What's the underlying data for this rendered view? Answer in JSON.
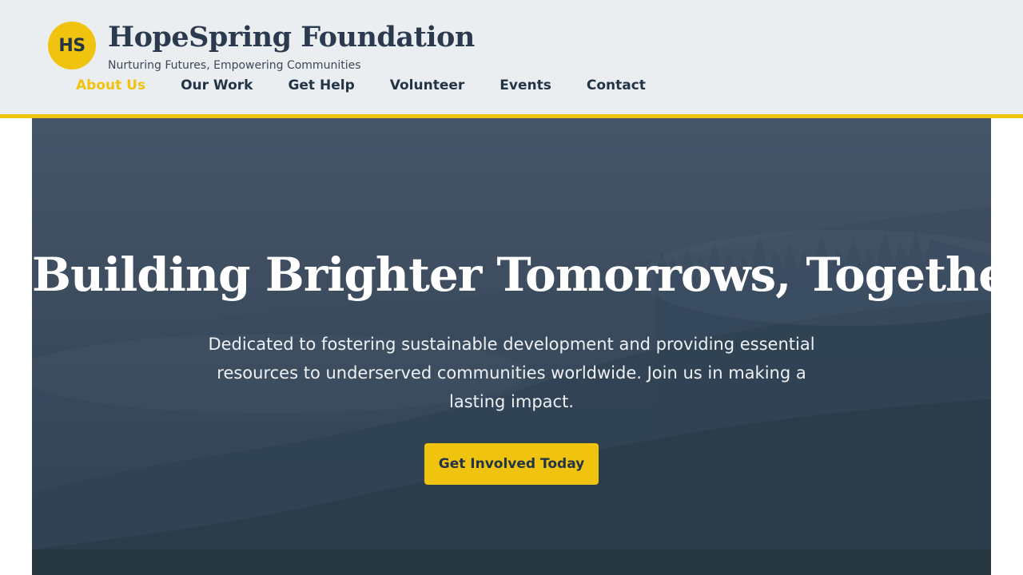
{
  "brand": {
    "badge": "HS",
    "name": "HopeSpring Foundation",
    "tagline": "Nurturing Futures, Empowering Communities"
  },
  "nav": {
    "items": [
      {
        "label": "About Us",
        "active": true
      },
      {
        "label": "Our Work"
      },
      {
        "label": "Get Help"
      },
      {
        "label": "Volunteer"
      },
      {
        "label": "Events"
      },
      {
        "label": "Contact"
      }
    ]
  },
  "hero": {
    "title": "Building Brighter Tomorrows, Together.",
    "subtitle": "Dedicated to fostering sustainable development and providing essential resources to underserved communities worldwide. Join us in making a lasting impact.",
    "cta_label": "Get Involved Today",
    "background_icon": "forest-hills-image"
  },
  "colors": {
    "accent": "#f0c30f",
    "navy": "#243447",
    "header_bg": "#ebeef0"
  }
}
